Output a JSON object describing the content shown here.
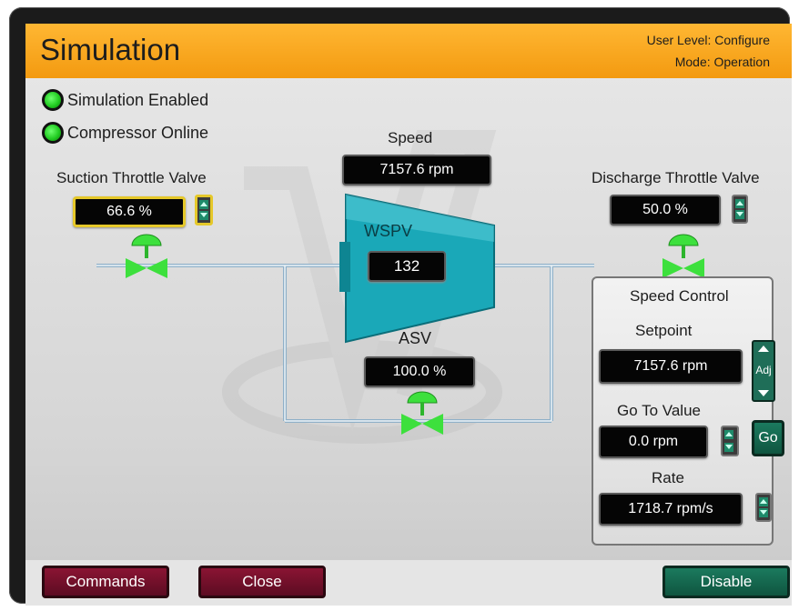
{
  "header": {
    "title": "Simulation",
    "user_level": "User Level: Configure",
    "mode": "Mode: Operation"
  },
  "indicators": [
    {
      "label": "Simulation Enabled",
      "color": "#22cc22"
    },
    {
      "label": "Compressor Online",
      "color": "#22cc22"
    }
  ],
  "suction": {
    "label": "Suction Throttle Valve",
    "value": "66.6 %"
  },
  "discharge": {
    "label": "Discharge Throttle Valve",
    "value": "50.0 %"
  },
  "speed": {
    "label": "Speed",
    "value": "7157.6 rpm"
  },
  "compressor": {
    "label": "WSPV",
    "value": "132"
  },
  "asv": {
    "label": "ASV",
    "value": "100.0 %"
  },
  "speed_control": {
    "title": "Speed Control",
    "setpoint_label": "Setpoint",
    "setpoint_value": "7157.6 rpm",
    "adj_label": "Adj",
    "goto_label": "Go To Value",
    "goto_value": "0.0 rpm",
    "go_label": "Go",
    "rate_label": "Rate",
    "rate_value": "1718.7 rpm/s"
  },
  "buttons": {
    "commands": "Commands",
    "close": "Close",
    "disable": "Disable"
  },
  "colors": {
    "header": "#f39a10",
    "accent_green": "#1b7a5e",
    "button_red": "#8a1433",
    "valve": "#3de03d",
    "compressor": "#1aa8b8"
  }
}
